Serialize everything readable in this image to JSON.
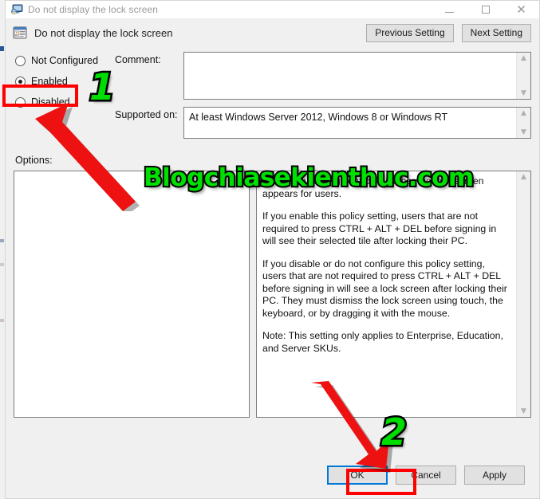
{
  "window": {
    "title": "Do not display the lock screen",
    "icon": "policy-monitor-icon",
    "controls": {
      "minimize": "minimize-icon",
      "maximize": "maximize-icon",
      "close": "✕"
    }
  },
  "header": {
    "icon": "group-policy-setting-icon",
    "title": "Do not display the lock screen",
    "previous_setting": "Previous Setting",
    "next_setting": "Next Setting"
  },
  "state_options": [
    {
      "label": "Not Configured",
      "checked": false
    },
    {
      "label": "Enabled",
      "checked": true
    },
    {
      "label": "Disabled",
      "checked": false
    }
  ],
  "fields": {
    "comment_label": "Comment:",
    "comment_value": "",
    "supported_label": "Supported on:",
    "supported_value": "At least Windows Server 2012, Windows 8 or Windows RT"
  },
  "options": {
    "label": "Options:",
    "value": ""
  },
  "help": {
    "paragraphs": [
      "This policy setting controls whether the lock screen appears for users.",
      "If you enable this policy setting, users that are not required to press CTRL + ALT + DEL before signing in will see their selected tile after locking their PC.",
      "If you disable or do not configure this policy setting, users that are not required to press CTRL + ALT + DEL before signing in will see a lock screen after locking their PC. They must dismiss the lock screen using touch, the keyboard, or by dragging it with the mouse.",
      "Note: This setting only applies to Enterprise, Education, and Server SKUs."
    ]
  },
  "footer": {
    "ok": "OK",
    "cancel": "Cancel",
    "apply": "Apply"
  },
  "annotations": {
    "step_one": "1",
    "step_two": "2",
    "watermark": "Blogchiasekienthuc.com",
    "highlight_color": "#ff0000",
    "number_color": "#00dd00",
    "arrow_color": "#ee1111"
  },
  "scroll": {
    "up": "▲",
    "down": "▼"
  }
}
